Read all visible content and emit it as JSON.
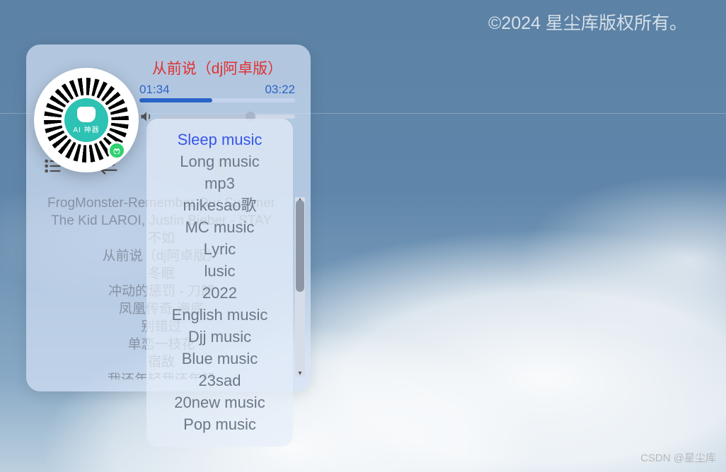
{
  "copyright": "©2024 星尘库版权所有。",
  "watermark": "CSDN @星尘库",
  "player": {
    "now_playing": "从前说（dj阿卓版）",
    "elapsed": "01:34",
    "duration": "03:22"
  },
  "qr": {
    "center_label": "AI 神器"
  },
  "tracks": [
    "FrogMonster-Remember Our Summer",
    "The Kid LAROI, Justin Bieber - STAY",
    "不如",
    "从前说（dj阿卓版）",
    "冬眠",
    "冲动的惩罚 - 刀郎",
    "凤凰传奇-海底",
    "别错过",
    "单恋一枝花",
    "宿敌",
    "我还年轻我还年轻"
  ],
  "categories": [
    "Sleep music",
    "Long music",
    "mp3",
    "mikesao歌",
    "MC music",
    "Lyric",
    "lusic",
    "2022",
    "English music",
    "Djj music",
    "Blue music",
    "23sad",
    "20new music",
    "Pop music"
  ],
  "selected_category_index": 0
}
